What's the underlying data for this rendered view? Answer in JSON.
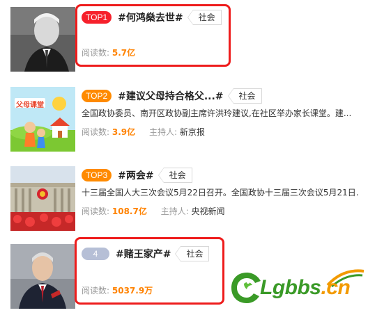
{
  "items": [
    {
      "rank": "TOP1",
      "topic": "#何鸿燊去世#",
      "tag": "社会",
      "reads_label": "阅读数:",
      "reads_value": "5.7亿"
    },
    {
      "rank": "TOP2",
      "topic": "#建议父母持合格父...#",
      "tag": "社会",
      "desc": "全国政协委员、南开区政协副主席许洪玲建议,在社区举办家长课堂。建...",
      "reads_label": "阅读数:",
      "reads_value": "3.9亿",
      "host_label": "主持人:",
      "host": "新京报",
      "thumb_text": "父母课堂"
    },
    {
      "rank": "TOP3",
      "topic": "#两会#",
      "tag": "社会",
      "desc": "十三届全国人大三次会议5月22日召开。全国政协十三届三次会议5月21日...",
      "reads_label": "阅读数:",
      "reads_value": "108.7亿",
      "host_label": "主持人:",
      "host": "央视新闻"
    },
    {
      "rank": "4",
      "topic": "#赌王家产#",
      "tag": "社会",
      "reads_label": "阅读数:",
      "reads_value": "5037.9万"
    }
  ],
  "watermark": {
    "brand": "Lgbbs",
    "domain": ".cn"
  },
  "colors": {
    "top1_badge": "#f6202b",
    "top_badge": "#ff8a00",
    "plain_badge": "#b6bfd6",
    "read_count": "#ff8200",
    "highlight_box": "#ee1c1c"
  }
}
